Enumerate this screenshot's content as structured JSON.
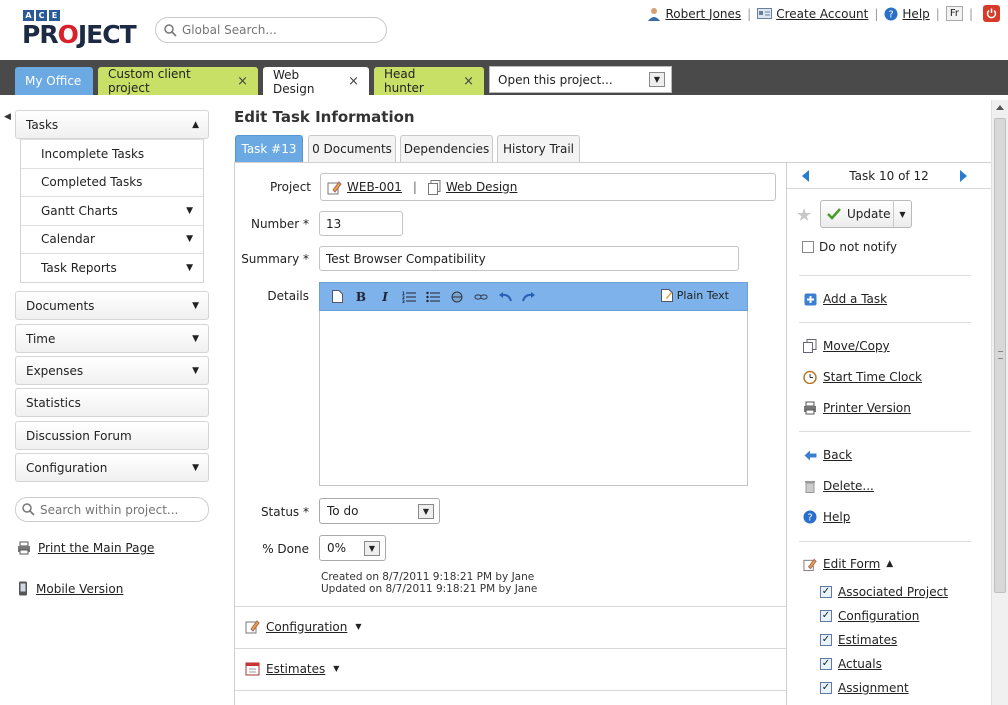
{
  "header": {
    "logo_ace": [
      "A",
      "C",
      "E"
    ],
    "logo_text_pre": "PR",
    "logo_text_o": "O",
    "logo_text_post": "JECT",
    "global_search_placeholder": "Global Search...",
    "user_name": "Robert Jones",
    "create_account": "Create Account",
    "help": "Help",
    "lang": "Fr"
  },
  "project_tabs": {
    "my_office": "My Office",
    "custom_client": "Custom client project",
    "web_design": "Web Design",
    "head_hunter": "Head hunter",
    "close_glyph": "×",
    "open_project": "Open this project..."
  },
  "sidebar": {
    "tasks": "Tasks",
    "task_items": [
      "Incomplete Tasks",
      "Completed Tasks",
      "Gantt Charts",
      "Calendar",
      "Task Reports"
    ],
    "documents": "Documents",
    "time": "Time",
    "expenses": "Expenses",
    "statistics": "Statistics",
    "discussion_forum": "Discussion Forum",
    "configuration": "Configuration",
    "search_placeholder": "Search within project...",
    "print_main": "Print the Main Page",
    "mobile_version": "Mobile Version"
  },
  "main": {
    "title": "Edit Task Information",
    "tabs": {
      "task": "Task #13",
      "documents": "0 Documents",
      "dependencies": "Dependencies",
      "history": "History Trail"
    },
    "labels": {
      "project": "Project",
      "number": "Number *",
      "summary": "Summary *",
      "details": "Details",
      "status": "Status *",
      "percent_done": "% Done"
    },
    "project_code": "WEB-001",
    "project_name": "Web Design",
    "project_sep": "|",
    "number": "13",
    "summary": "Test Browser Compatibility",
    "editor_plain_text": "Plain Text",
    "status": "To do",
    "percent_done": "0%",
    "created": "Created on 8/7/2011 9:18:21 PM by Jane",
    "updated": "Updated on 8/7/2011 9:18:21 PM by Jane",
    "section_configuration": "Configuration",
    "section_estimates": "Estimates"
  },
  "right_panel": {
    "pager": "Task 10 of 12",
    "update": "Update",
    "do_not_notify": "Do not notify",
    "add_task": "Add a Task",
    "move_copy": "Move/Copy",
    "start_time_clock": "Start Time Clock",
    "printer_version": "Printer Version",
    "back": "Back",
    "delete": "Delete...",
    "help": "Help",
    "edit_form": "Edit Form",
    "edit_form_items": [
      "Associated Project",
      "Configuration",
      "Estimates",
      "Actuals",
      "Assignment"
    ]
  },
  "colors": {
    "tab_blue": "#6aa9e2",
    "tab_green": "#c8e066",
    "tabbar_dark": "#4a4a4a",
    "editor_toolbar": "#7db3ea",
    "logo_red": "#d8212a"
  }
}
